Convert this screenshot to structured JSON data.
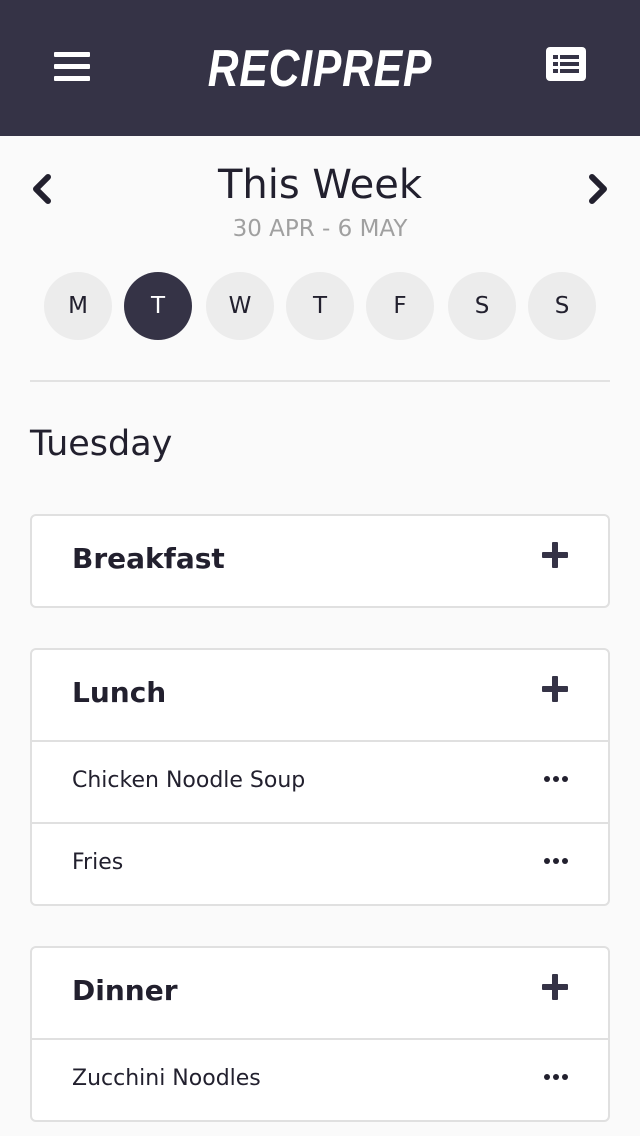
{
  "header": {
    "app_name": "RECIPREP",
    "menu_icon": "hamburger-menu-icon",
    "list_icon": "list-view-icon",
    "background_color": "#353346"
  },
  "week": {
    "title": "This Week",
    "range": "30 APR - 6 MAY",
    "prev_icon": "chevron-left-icon",
    "next_icon": "chevron-right-icon"
  },
  "days": [
    {
      "label": "M",
      "active": false
    },
    {
      "label": "T",
      "active": true
    },
    {
      "label": "W",
      "active": false
    },
    {
      "label": "T",
      "active": false
    },
    {
      "label": "F",
      "active": false
    },
    {
      "label": "S",
      "active": false
    },
    {
      "label": "S",
      "active": false
    }
  ],
  "selected_day": "Tuesday",
  "meals": [
    {
      "title": "Breakfast",
      "items": []
    },
    {
      "title": "Lunch",
      "items": [
        "Chicken Noodle Soup",
        "Fries"
      ]
    },
    {
      "title": "Dinner",
      "items": [
        "Zucchini Noodles"
      ]
    }
  ],
  "colors": {
    "accent": "#353346",
    "muted_text": "#a0a0a0",
    "day_inactive": "#ececec"
  }
}
